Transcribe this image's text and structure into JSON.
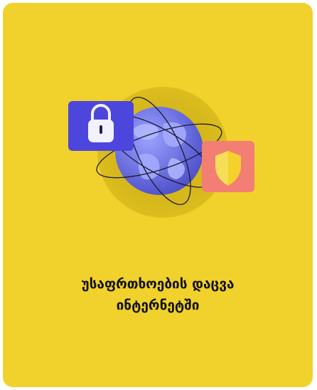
{
  "card": {
    "background_color": "#f1d22c",
    "title_line_1": "უსაფრთხოების დაცვა",
    "title_line_2": "ინტერნეტში"
  },
  "illustration": {
    "globe_icon": "globe-icon",
    "lock_icon": "padlock-icon",
    "shield_icon": "shield-icon",
    "lock_badge_color": "#4d46dc",
    "shield_badge_color": "#f37e73",
    "shield_color": "#f4d12b",
    "globe_color": "#6a72ee"
  }
}
